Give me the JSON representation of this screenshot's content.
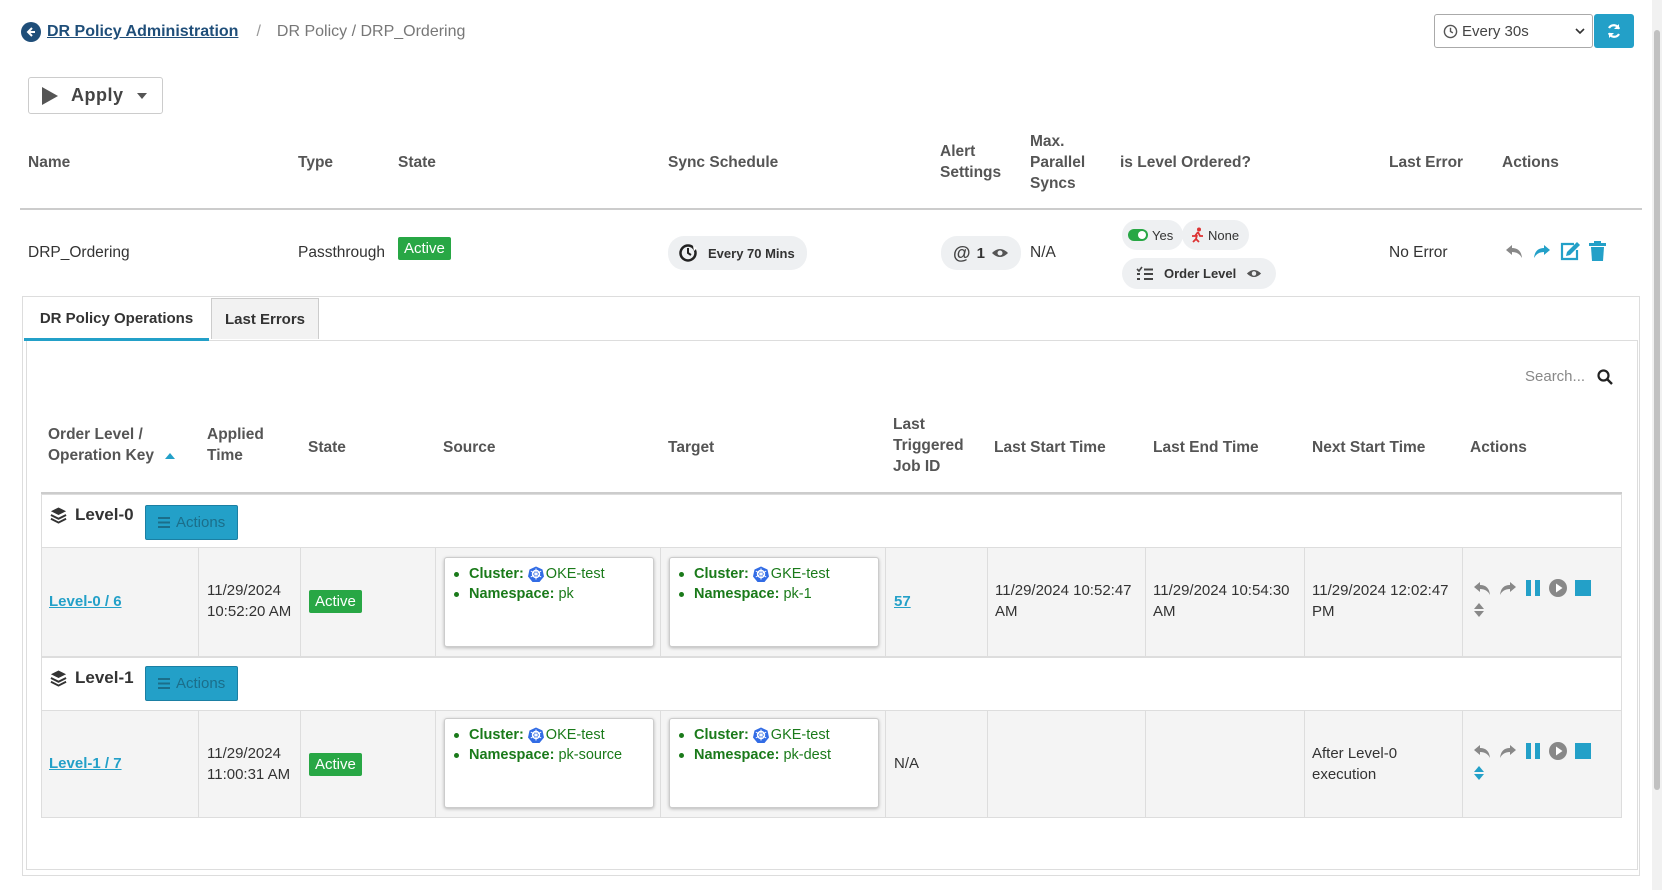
{
  "breadcrumb": {
    "link": "DR Policy Administration",
    "separator": "/",
    "current": "DR Policy / DRP_Ordering"
  },
  "refresh": {
    "interval": "Every 30s"
  },
  "apply": {
    "label": "Apply"
  },
  "policy_table": {
    "headers": {
      "name": "Name",
      "type": "Type",
      "state": "State",
      "sync": "Sync Schedule",
      "alert": [
        "Alert",
        "Settings"
      ],
      "maxpar": [
        "Max.",
        "Parallel",
        "Syncs"
      ],
      "level_ordered": "is Level Ordered?",
      "last_error": "Last Error",
      "actions": "Actions"
    },
    "row": {
      "name": "DRP_Ordering",
      "type": "Passthrough",
      "state": "Active",
      "sync": "Every 70 Mins",
      "alert_count": "1",
      "maxpar": "N/A",
      "ordered_yes": "Yes",
      "ordered_none": "None",
      "order_level": "Order Level",
      "last_error": "No Error"
    }
  },
  "tabs": {
    "operations": "DR Policy Operations",
    "errors": "Last Errors"
  },
  "search": {
    "placeholder": "Search..."
  },
  "ops_table": {
    "headers": {
      "order": [
        "Order Level /",
        "Operation Key"
      ],
      "applied": [
        "Applied",
        "Time"
      ],
      "state": "State",
      "source": "Source",
      "target": "Target",
      "job": [
        "Last",
        "Triggered",
        "Job ID"
      ],
      "start": "Last Start Time",
      "end": "Last End Time",
      "next": "Next Start Time",
      "actions": "Actions"
    },
    "levels": [
      {
        "title": "Level-0",
        "actions_label": "Actions",
        "op": {
          "key": "Level-0 / 6",
          "applied": [
            "11/29/2024",
            "10:52:20 AM"
          ],
          "state": "Active",
          "src_cluster": "OKE-test",
          "src_ns": "pk",
          "tgt_cluster": "GKE-test",
          "tgt_ns": "pk-1",
          "job": "57",
          "start": [
            "11/29/2024 10:52:47",
            "AM"
          ],
          "end": [
            "11/29/2024 10:54:30",
            "AM"
          ],
          "next": [
            "11/29/2024 12:02:47",
            "PM"
          ]
        }
      },
      {
        "title": "Level-1",
        "actions_label": "Actions",
        "op": {
          "key": "Level-1 / 7",
          "applied": [
            "11/29/2024",
            "11:00:31 AM"
          ],
          "state": "Active",
          "src_cluster": "OKE-test",
          "src_ns": "pk-source",
          "tgt_cluster": "GKE-test",
          "tgt_ns": "pk-dest",
          "job": "N/A",
          "start": [
            "",
            ""
          ],
          "end": [
            "",
            ""
          ],
          "next": [
            "After Level-0",
            "execution"
          ]
        }
      }
    ],
    "labels": {
      "cluster": "Cluster:",
      "namespace": "Namespace:"
    }
  },
  "colors": {
    "accent": "#23a0c8",
    "active": "#28a745",
    "link_dark": "#1f4e79",
    "card_text": "#1a7a1a"
  }
}
